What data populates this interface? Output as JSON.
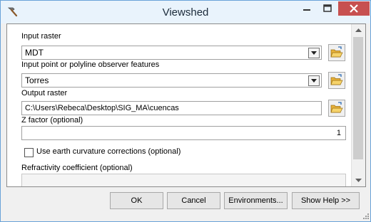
{
  "window": {
    "title": "Viewshed",
    "app_icon": "hammer-icon"
  },
  "titlebar_buttons": {
    "minimize": "minimize-icon",
    "maximize": "maximize-icon",
    "close": "close-icon"
  },
  "form": {
    "input_raster": {
      "label": "Input raster",
      "value": "MDT"
    },
    "observer_features": {
      "label": "Input point or polyline observer features",
      "value": "Torres"
    },
    "output_raster": {
      "label": "Output raster",
      "value": "C:\\Users\\Rebeca\\Desktop\\SIG_MA\\cuencas"
    },
    "z_factor": {
      "label": "Z factor (optional)",
      "value": "1"
    },
    "earth_curvature": {
      "label": "Use earth curvature corrections (optional)",
      "checked": false
    },
    "refractivity": {
      "label": "Refractivity coefficient (optional)"
    }
  },
  "buttons": {
    "ok": "OK",
    "cancel": "Cancel",
    "environments": "Environments...",
    "help": "Show Help >>"
  },
  "colors": {
    "titlebar": "#e9f3fc",
    "close": "#c75050",
    "window_border": "#6aa2d8"
  }
}
